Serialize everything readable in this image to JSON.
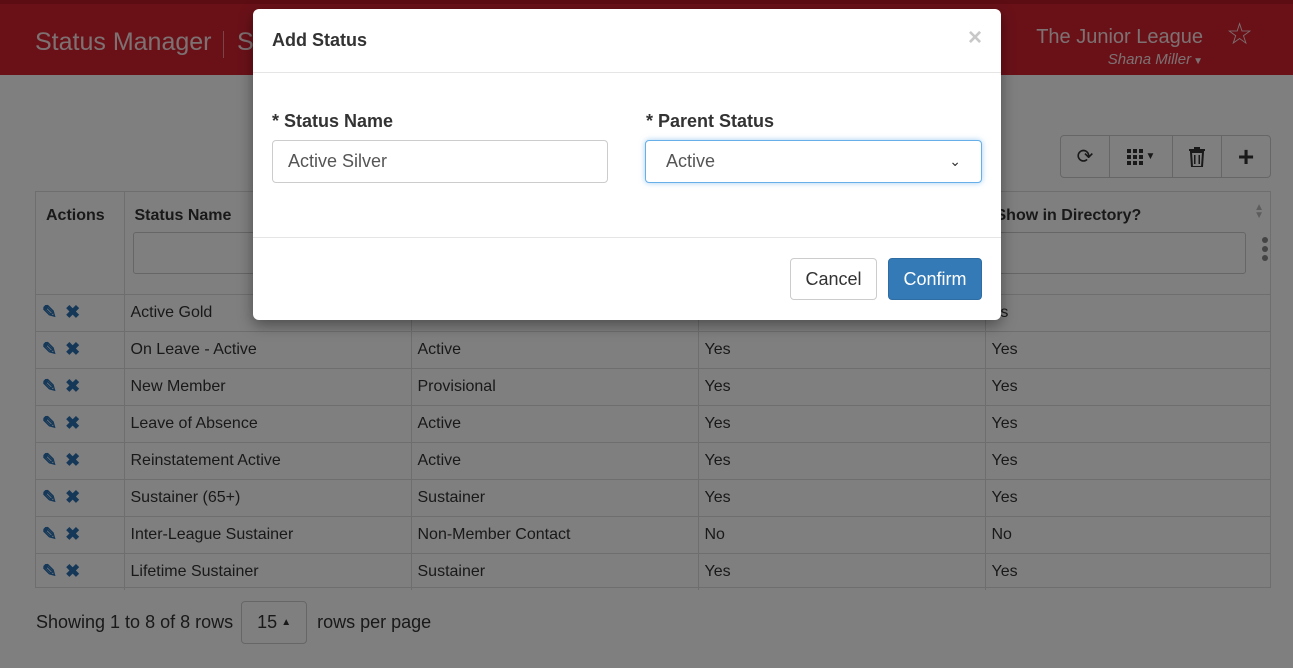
{
  "header": {
    "app_title": "Status Manager",
    "app_subtitle": "S",
    "org_name": "The Junior League",
    "user_name": "Shana Miller"
  },
  "toolbar": {
    "refresh_icon": "refresh-icon",
    "columns_icon": "columns-grid-icon",
    "delete_icon": "trash-icon",
    "add_icon": "plus-icon"
  },
  "table": {
    "columns": [
      "Actions",
      "Status Name",
      "",
      "",
      "Show in Directory?"
    ],
    "rows": [
      {
        "name": "Active Gold",
        "parent": "",
        "third": "",
        "directory": "es"
      },
      {
        "name": "On Leave - Active",
        "parent": "Active",
        "third": "Yes",
        "directory": "Yes"
      },
      {
        "name": "New Member",
        "parent": "Provisional",
        "third": "Yes",
        "directory": "Yes"
      },
      {
        "name": "Leave of Absence",
        "parent": "Active",
        "third": "Yes",
        "directory": "Yes"
      },
      {
        "name": "Reinstatement Active",
        "parent": "Active",
        "third": "Yes",
        "directory": "Yes"
      },
      {
        "name": "Sustainer (65+)",
        "parent": "Sustainer",
        "third": "Yes",
        "directory": "Yes"
      },
      {
        "name": "Inter-League Sustainer",
        "parent": "Non-Member Contact",
        "third": "No",
        "directory": "No"
      },
      {
        "name": "Lifetime Sustainer",
        "parent": "Sustainer",
        "third": "Yes",
        "directory": "Yes"
      }
    ]
  },
  "pagination": {
    "summary": "Showing 1 to 8 of 8 rows",
    "page_size": "15",
    "suffix": "rows per page"
  },
  "modal": {
    "title": "Add Status",
    "close_symbol": "×",
    "status_name_label": "* Status Name",
    "status_name_value": "Active Silver",
    "parent_status_label": "* Parent Status",
    "parent_status_value": "Active",
    "cancel_label": "Cancel",
    "confirm_label": "Confirm"
  },
  "colors": {
    "header_bg": "#d42230",
    "primary_button": "#337ab7",
    "action_icon": "#2a6fb0"
  }
}
